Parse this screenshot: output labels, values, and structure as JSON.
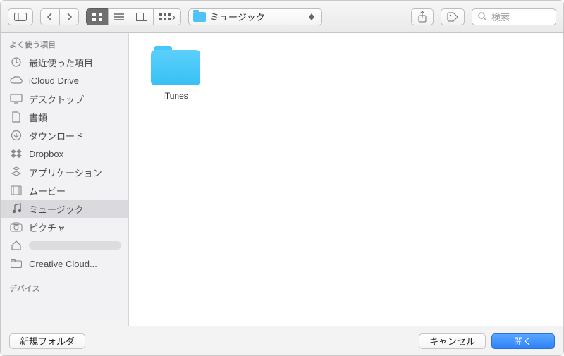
{
  "toolbar": {
    "path_label": "ミュージック",
    "search_placeholder": "検索"
  },
  "sidebar": {
    "favorites_header": "よく使う項目",
    "items": [
      {
        "label": "最近使った項目",
        "icon": "clock"
      },
      {
        "label": "iCloud Drive",
        "icon": "cloud"
      },
      {
        "label": "デスクトップ",
        "icon": "desktop"
      },
      {
        "label": "書類",
        "icon": "doc"
      },
      {
        "label": "ダウンロード",
        "icon": "download"
      },
      {
        "label": "Dropbox",
        "icon": "dropbox"
      },
      {
        "label": "アプリケーション",
        "icon": "apps"
      },
      {
        "label": "ムービー",
        "icon": "movie"
      },
      {
        "label": "ミュージック",
        "icon": "music",
        "selected": true
      },
      {
        "label": "ピクチャ",
        "icon": "camera"
      },
      {
        "label": "",
        "icon": "home"
      },
      {
        "label": "Creative Cloud...",
        "icon": "cc"
      }
    ],
    "devices_header": "デバイス"
  },
  "content": {
    "items": [
      {
        "name": "iTunes",
        "type": "folder"
      }
    ]
  },
  "footer": {
    "new_folder": "新規フォルダ",
    "cancel": "キャンセル",
    "open": "開く"
  }
}
